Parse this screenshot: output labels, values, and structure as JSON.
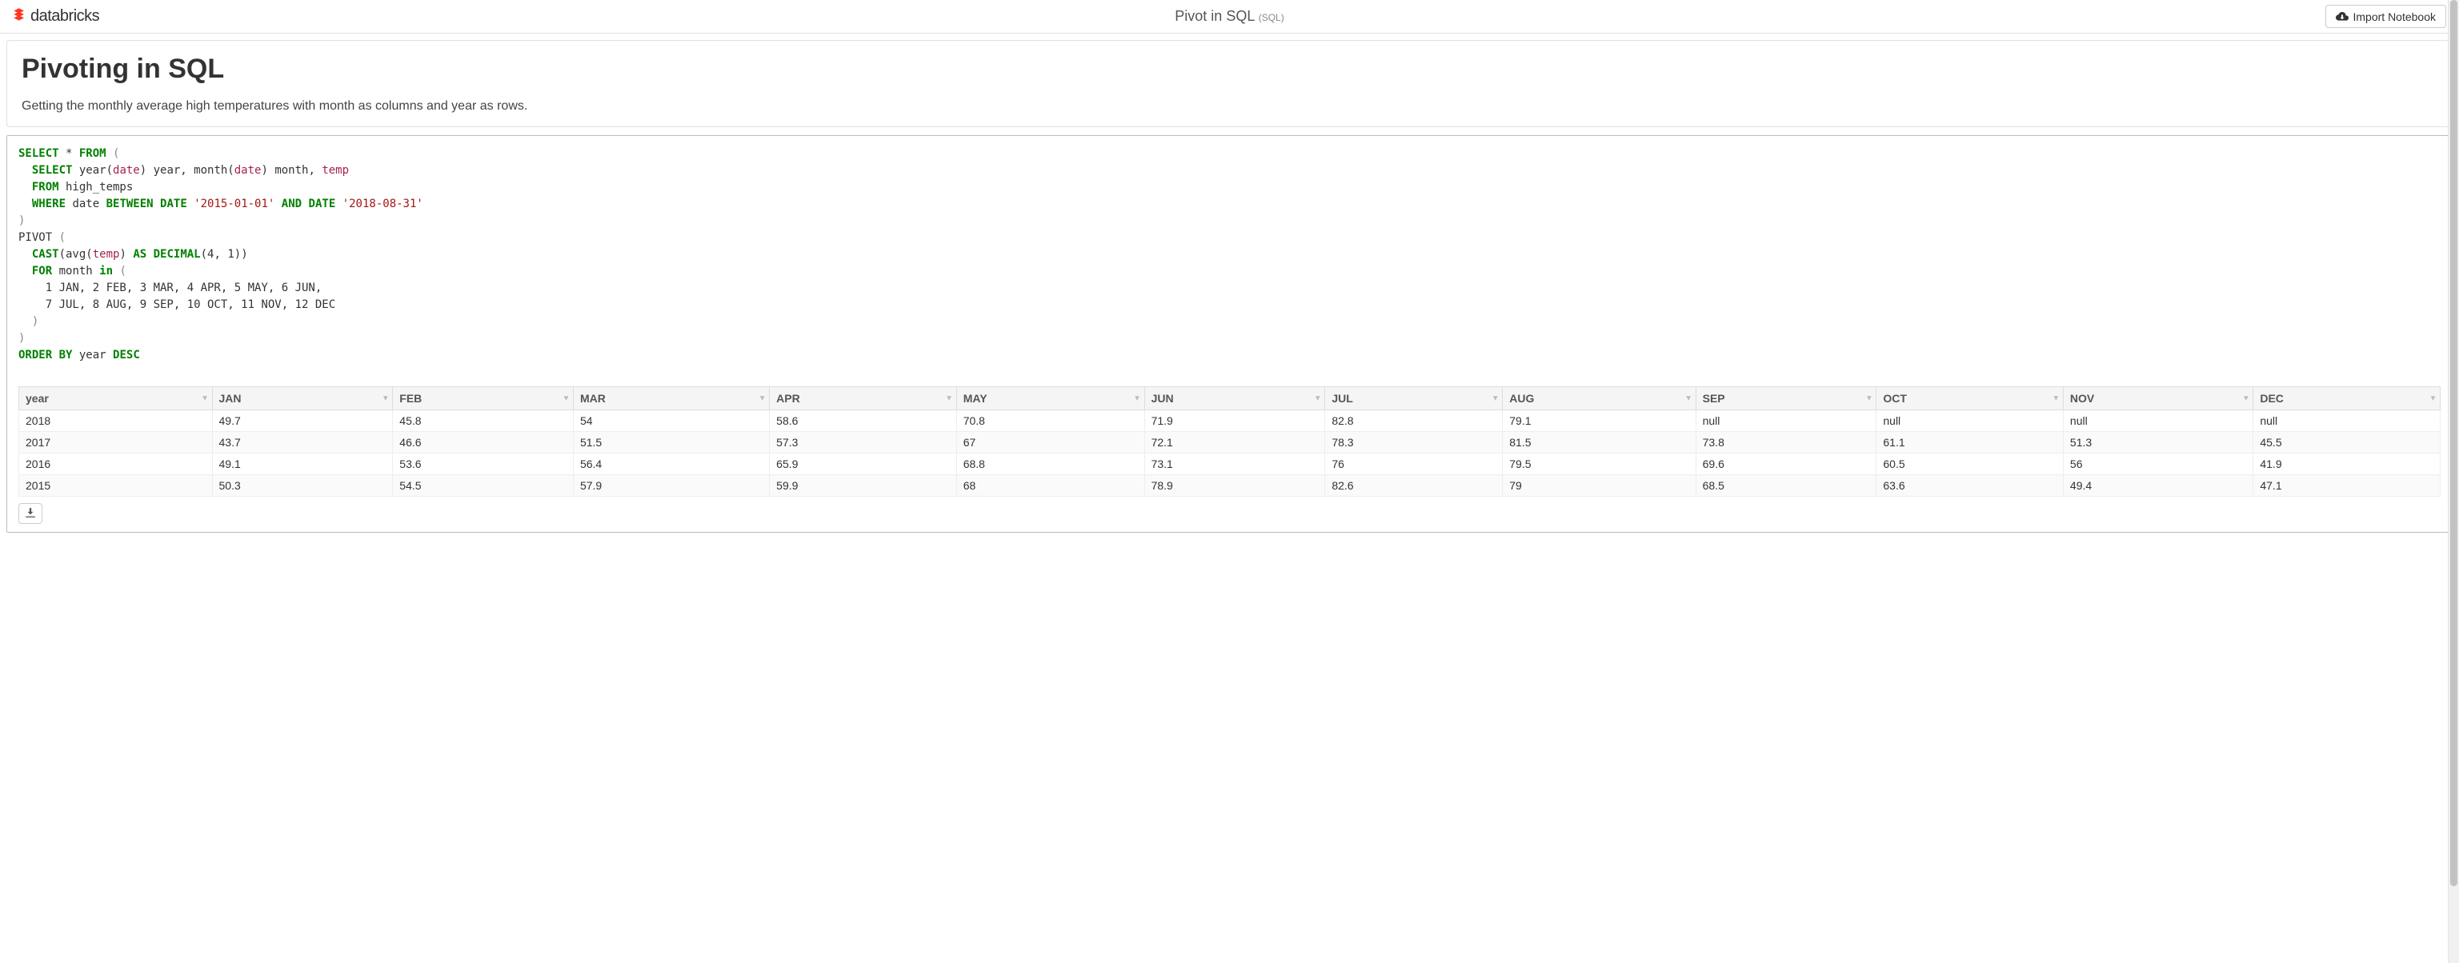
{
  "header": {
    "logo_text": "databricks",
    "title": "Pivot in SQL",
    "lang": "(SQL)",
    "import_label": "Import Notebook"
  },
  "md": {
    "heading": "Pivoting in SQL",
    "body": "Getting the monthly average high temperatures with month as columns and year as rows."
  },
  "sql": {
    "line1_select": "SELECT",
    "line1_star": " * ",
    "line1_from": "FROM",
    "line1_open": " (",
    "line2_indent": "  ",
    "line2_select": "SELECT",
    "line2_body_a": " year(",
    "line2_date1": "date",
    "line2_body_b": ") year, month(",
    "line2_date2": "date",
    "line2_body_c": ") month, ",
    "line2_temp": "temp",
    "line3_indent": "  ",
    "line3_from": "FROM",
    "line3_table": " high_temps",
    "line4_indent": "  ",
    "line4_where": "WHERE",
    "line4_date_a": " date ",
    "line4_between": "BETWEEN",
    "line4_sp": " ",
    "line4_datekw1": "DATE",
    "line4_sp2": " ",
    "line4_str1": "'2015-01-01'",
    "line4_sp3": " ",
    "line4_and": "AND",
    "line4_sp4": " ",
    "line4_datekw2": "DATE",
    "line4_sp5": " ",
    "line4_str2": "'2018-08-31'",
    "line5_close": ")",
    "line6_pivot": "PIVOT",
    "line6_open": " (",
    "line7_indent": "  ",
    "line7_cast": "CAST",
    "line7_p1": "(avg(",
    "line7_temp": "temp",
    "line7_p2": ") ",
    "line7_as": "AS",
    "line7_sp": " ",
    "line7_decimal": "DECIMAL",
    "line7_args": "(4, 1))",
    "line8_indent": "  ",
    "line8_for": "FOR",
    "line8_month": " month ",
    "line8_in": "in",
    "line8_open": " (",
    "line9": "    1 JAN, 2 FEB, 3 MAR, 4 APR, 5 MAY, 6 JUN,",
    "line10": "    7 JUL, 8 AUG, 9 SEP, 10 OCT, 11 NOV, 12 DEC",
    "line11": "  )",
    "line12": ")",
    "line13_order": "ORDER",
    "line13_sp": " ",
    "line13_by": "BY",
    "line13_year": " year ",
    "line13_desc": "DESC"
  },
  "table": {
    "columns": [
      "year",
      "JAN",
      "FEB",
      "MAR",
      "APR",
      "MAY",
      "JUN",
      "JUL",
      "AUG",
      "SEP",
      "OCT",
      "NOV",
      "DEC"
    ],
    "rows": [
      [
        "2018",
        "49.7",
        "45.8",
        "54",
        "58.6",
        "70.8",
        "71.9",
        "82.8",
        "79.1",
        "null",
        "null",
        "null",
        "null"
      ],
      [
        "2017",
        "43.7",
        "46.6",
        "51.5",
        "57.3",
        "67",
        "72.1",
        "78.3",
        "81.5",
        "73.8",
        "61.1",
        "51.3",
        "45.5"
      ],
      [
        "2016",
        "49.1",
        "53.6",
        "56.4",
        "65.9",
        "68.8",
        "73.1",
        "76",
        "79.5",
        "69.6",
        "60.5",
        "56",
        "41.9"
      ],
      [
        "2015",
        "50.3",
        "54.5",
        "57.9",
        "59.9",
        "68",
        "78.9",
        "82.6",
        "79",
        "68.5",
        "63.6",
        "49.4",
        "47.1"
      ]
    ]
  }
}
